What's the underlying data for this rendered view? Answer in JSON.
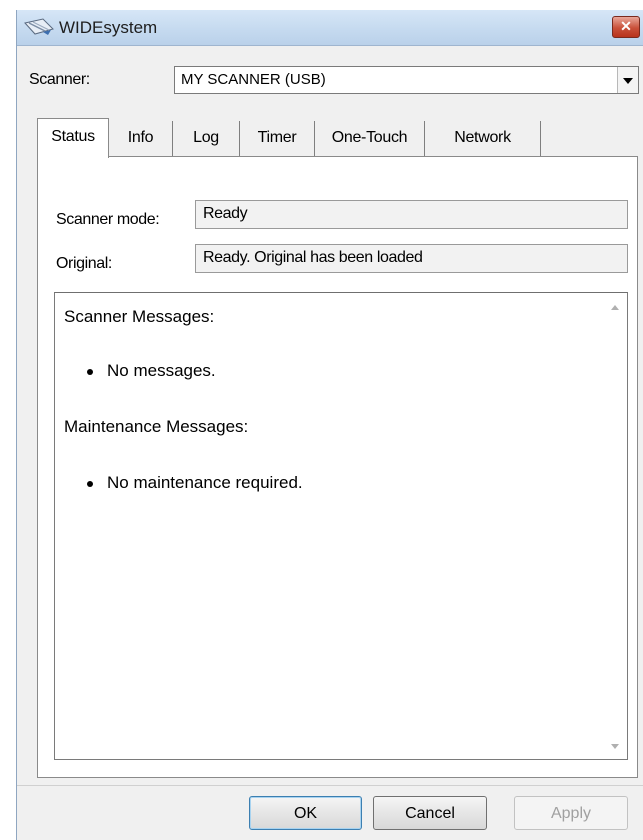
{
  "window": {
    "title": "WIDEsystem",
    "close_glyph": "✕",
    "icon": "scanner-app-icon"
  },
  "scanner": {
    "label": "Scanner:",
    "selected": "MY SCANNER (USB)"
  },
  "tabs": [
    {
      "label": "Status",
      "active": true
    },
    {
      "label": "Info",
      "active": false
    },
    {
      "label": "Log",
      "active": false
    },
    {
      "label": "Timer",
      "active": false
    },
    {
      "label": "One-Touch",
      "active": false
    },
    {
      "label": "Network",
      "active": false
    }
  ],
  "status": {
    "mode_label": "Scanner mode:",
    "mode_value": "Ready",
    "original_label": "Original:",
    "original_value": "Ready. Original has been loaded"
  },
  "messages": {
    "scanner_heading": "Scanner Messages:",
    "scanner_items": [
      "No messages."
    ],
    "maintenance_heading": "Maintenance Messages:",
    "maintenance_items": [
      "No maintenance required."
    ]
  },
  "buttons": {
    "ok": "OK",
    "cancel": "Cancel",
    "apply": "Apply"
  },
  "colors": {
    "titlebar": "#c4d9ef",
    "close_button": "#c9503a",
    "dialog_background": "#f0f0f0"
  }
}
